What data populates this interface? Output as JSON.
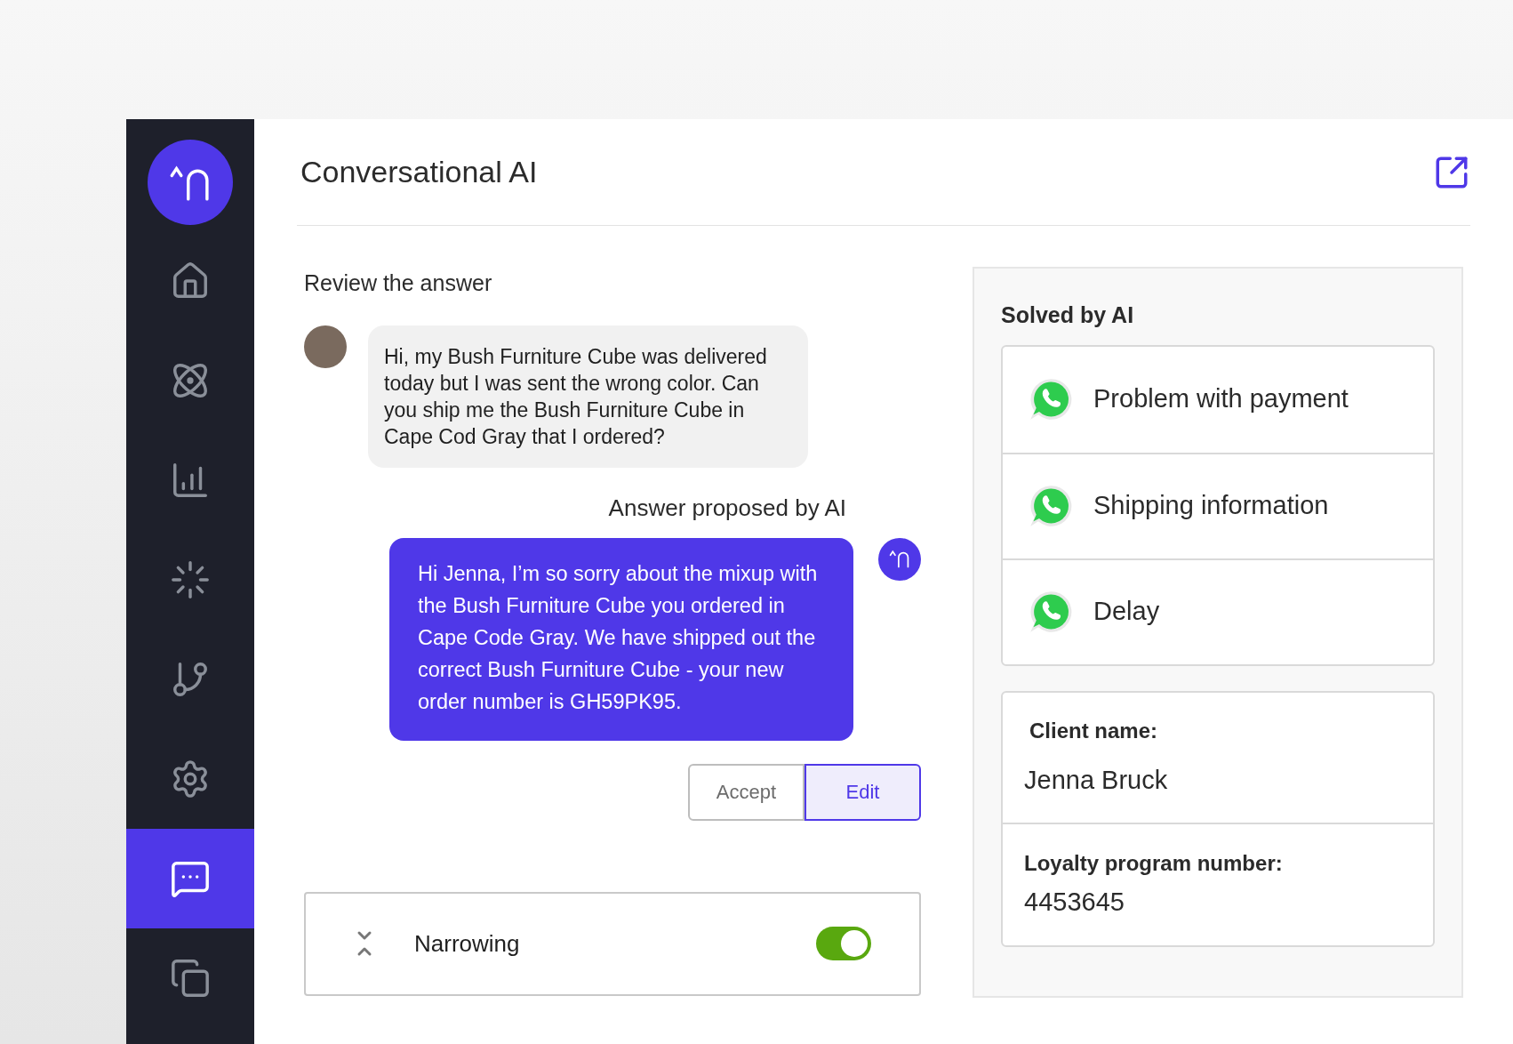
{
  "sidebar": {
    "items": [
      {
        "selected": false
      },
      {
        "selected": false
      },
      {
        "selected": false
      },
      {
        "selected": false
      },
      {
        "selected": false
      },
      {
        "selected": false
      },
      {
        "selected": true
      },
      {
        "selected": false
      }
    ]
  },
  "header": {
    "title": "Conversational AI"
  },
  "review": {
    "heading": "Review the answer",
    "customer_message": "Hi, my Bush Furniture Cube was delivered today but I was sent the wrong color. Can you ship me the Bush Furniture Cube in Cape Cod Gray that I ordered?",
    "proposed_label": "Answer proposed by AI",
    "ai_message": "Hi Jenna, I’m so sorry about the mixup with the Bush Furniture Cube you ordered in Cape Code Gray. We have shipped out the correct Bush Furniture Cube - your new order number is GH59PK95.",
    "buttons": [
      {
        "label": "Accept",
        "selected": false
      },
      {
        "label": "Edit",
        "selected": true
      }
    ]
  },
  "narrowing": {
    "label": "Narrowing",
    "on": true
  },
  "solved": {
    "title": "Solved by AI",
    "items": [
      "Problem with payment",
      "Shipping information",
      "Delay"
    ]
  },
  "client": {
    "name_label": "Client name:",
    "name": "Jenna Bruck",
    "loyalty_label": "Loyalty program number:",
    "loyalty_number": "4453645"
  }
}
